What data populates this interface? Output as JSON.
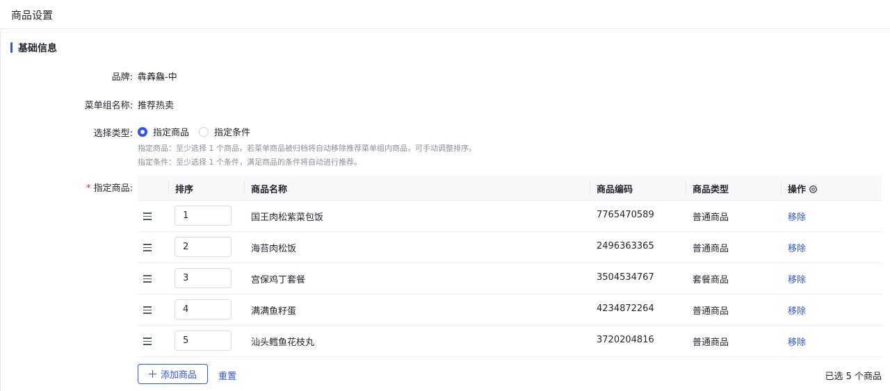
{
  "header": {
    "title": "商品设置"
  },
  "section": {
    "title": "基础信息"
  },
  "form": {
    "brand_label": "品牌:",
    "brand_value": "犇羴鱻-中",
    "menu_group_label": "菜单组名称:",
    "menu_group_value": "推荐热卖",
    "select_type_label": "选择类型:",
    "options": [
      {
        "label": "指定商品",
        "checked": true
      },
      {
        "label": "指定条件",
        "checked": false
      }
    ],
    "hint_1": "指定商品：至少选择 1 个商品，若菜单商品被归档将自动移除推荐菜单组内商品，可手动调整排序。",
    "hint_2": "指定条件：至少选择 1 个条件，满足商品的条件将自动进行推荐。",
    "products_label": "指定商品:",
    "required_mark": "*"
  },
  "table": {
    "headers": {
      "order": "排序",
      "name": "商品名称",
      "code": "商品编码",
      "type": "商品类型",
      "action": "操作"
    },
    "rows": [
      {
        "order": "1",
        "name": "国王肉松紫菜包饭",
        "code": "7765470589",
        "type": "普通商品",
        "action": "移除"
      },
      {
        "order": "2",
        "name": "海苔肉松饭",
        "code": "2496363365",
        "type": "普通商品",
        "action": "移除"
      },
      {
        "order": "3",
        "name": "宫保鸡丁套餐",
        "code": "3504534767",
        "type": "套餐商品",
        "action": "移除"
      },
      {
        "order": "4",
        "name": "满满鱼籽蛋",
        "code": "4234872264",
        "type": "普通商品",
        "action": "移除"
      },
      {
        "order": "5",
        "name": "汕头鳕鱼花枝丸",
        "code": "3720204816",
        "type": "普通商品",
        "action": "移除"
      }
    ]
  },
  "footer": {
    "add_label": "添加商品",
    "reset_label": "重置",
    "selected_text": "已选 5 个商品"
  },
  "colors": {
    "accent": "#2f54eb",
    "required": "#f5222d"
  }
}
